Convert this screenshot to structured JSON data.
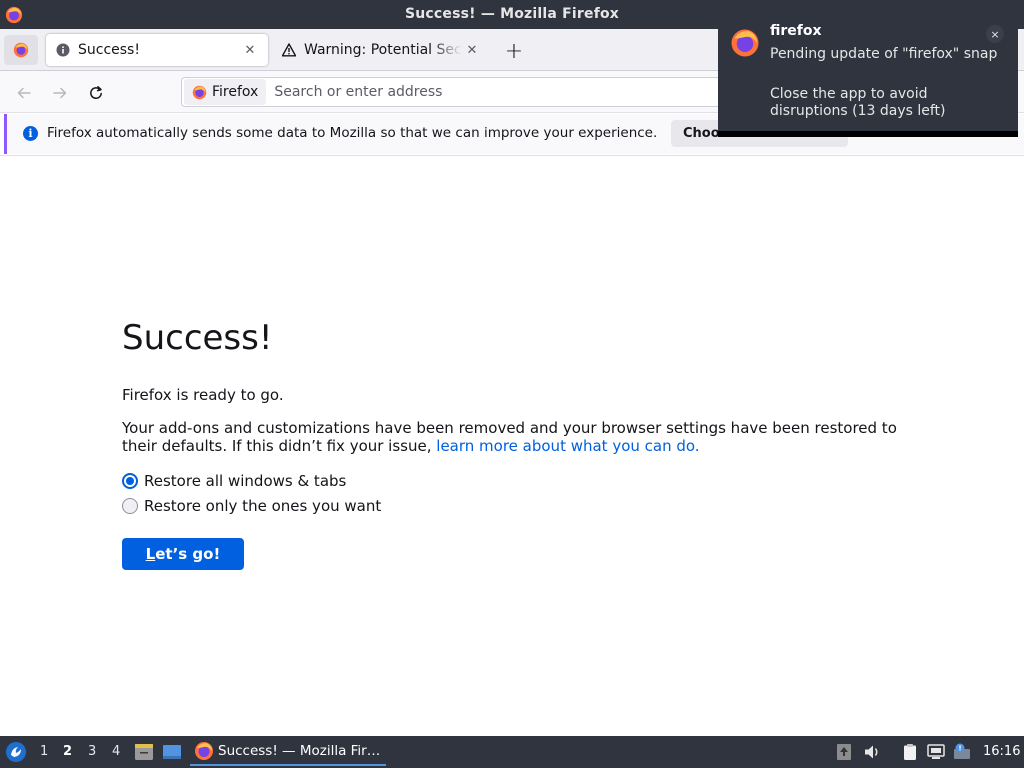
{
  "window": {
    "title": "Success! — Mozilla Firefox"
  },
  "tabs": [
    {
      "label": "Success!",
      "icon": "info-icon",
      "active": true
    },
    {
      "label": "Warning: Potential Security Risk Ahead",
      "icon": "warning-icon",
      "active": false
    }
  ],
  "navbar": {
    "identity_label": "Firefox",
    "url_placeholder": "Search or enter address"
  },
  "infobar": {
    "text": "Firefox automatically sends some data to Mozilla so that we can improve your experience.",
    "button_label": "Choose What I Share"
  },
  "page": {
    "heading": "Success!",
    "intro": "Firefox is ready to go.",
    "body": "Your add-ons and customizations have been removed and your browser settings have been restored to their defaults. If this didn’t fix your issue,",
    "link": "learn more about what you can do.",
    "options": [
      {
        "label": "Restore all windows & tabs",
        "checked": true
      },
      {
        "label": "Restore only the ones you want",
        "checked": false
      }
    ],
    "go_button": "et’s go!",
    "go_button_accel": "L"
  },
  "notification": {
    "app": "firefox",
    "line1": "Pending update of \"firefox\" snap",
    "line2": "Close the app to avoid disruptions (13 days left)",
    "close": "×"
  },
  "taskbar": {
    "workspaces": [
      "1",
      "2",
      "3",
      "4"
    ],
    "active_workspace": "2",
    "task_label": "Success! — Mozilla Fir…",
    "clock": "16:16"
  },
  "colors": {
    "accent": "#0060df",
    "panel": "#2f343f",
    "infobar_edge": "#9059ff"
  }
}
